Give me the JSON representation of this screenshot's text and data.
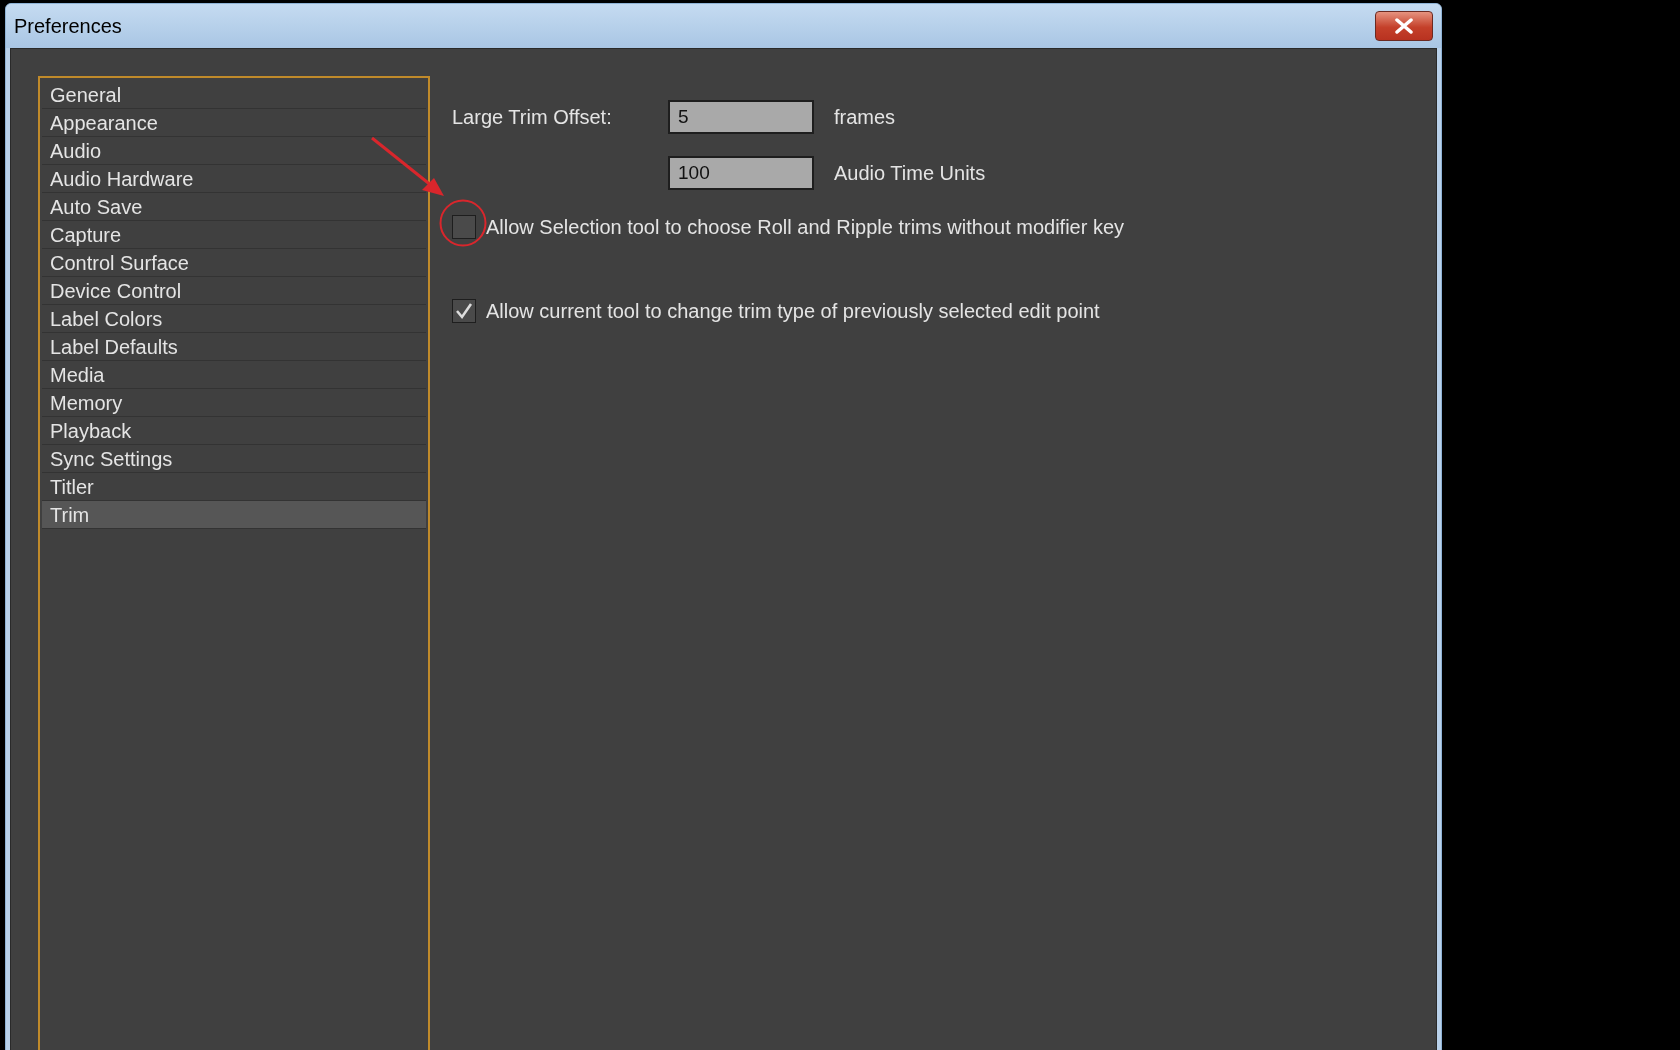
{
  "window": {
    "title": "Preferences"
  },
  "sidebar": {
    "items": [
      {
        "label": "General",
        "selected": false
      },
      {
        "label": "Appearance",
        "selected": false
      },
      {
        "label": "Audio",
        "selected": false
      },
      {
        "label": "Audio Hardware",
        "selected": false
      },
      {
        "label": "Auto Save",
        "selected": false
      },
      {
        "label": "Capture",
        "selected": false
      },
      {
        "label": "Control Surface",
        "selected": false
      },
      {
        "label": "Device Control",
        "selected": false
      },
      {
        "label": "Label Colors",
        "selected": false
      },
      {
        "label": "Label Defaults",
        "selected": false
      },
      {
        "label": "Media",
        "selected": false
      },
      {
        "label": "Memory",
        "selected": false
      },
      {
        "label": "Playback",
        "selected": false
      },
      {
        "label": "Sync Settings",
        "selected": false
      },
      {
        "label": "Titler",
        "selected": false
      },
      {
        "label": "Trim",
        "selected": true
      }
    ]
  },
  "fields": [
    {
      "label": "Large Trim Offset:",
      "value": "5",
      "unit": "frames"
    },
    {
      "value": "100",
      "unit": "Audio Time Units"
    }
  ],
  "options": [
    {
      "label": "Allow Selection tool to choose Roll and Ripple trims without modifier key",
      "checked": false,
      "highlighted": true
    },
    {
      "label": "Allow current tool to change trim type of previously selected edit point",
      "checked": true,
      "highlighted": false
    }
  ]
}
